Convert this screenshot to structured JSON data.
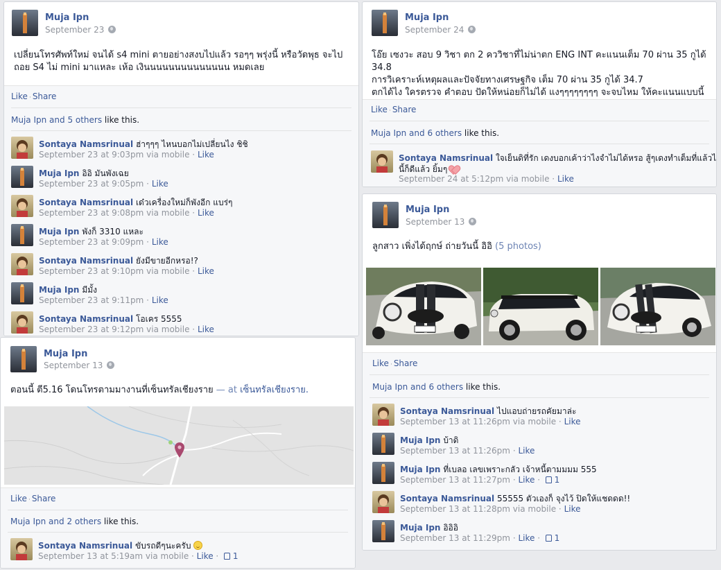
{
  "post1": {
    "author": "Muja Ipn",
    "date": "September 23",
    "text": "เปลี่ยนโทรศัพท์ใหม่ จนได้ s4 mini ตายอย่างสงบไปแล้ว รอๆๆ พรุ่งนี้ หรือวัดพุธ จะไปถอย S4 ไม่ mini มาแหละ เห้อ เงินนนนนนนนนนนนนน หมดเลย",
    "like_label": "Like",
    "share_label": "Share",
    "likes_prefix": "Muja Ipn and ",
    "likes_link": "5 others",
    "likes_suffix": " like this.",
    "comments": [
      {
        "name": "Sontaya Namsrinual",
        "text": "ฮ่าๆๆๆ ไหนบอกไม่เปลี่ยนไง ชิชิ",
        "meta": "September 23 at 9:03pm via mobile",
        "like": "Like"
      },
      {
        "name": "Muja Ipn",
        "text": "อิอิ มันพังเฉย",
        "meta": "September 23 at 9:05pm",
        "like": "Like"
      },
      {
        "name": "Sontaya Namsrinual",
        "text": "เด๋วเครื่องใหม่ก็พังอีก แบร่ๆ",
        "meta": "September 23 at 9:08pm via mobile",
        "like": "Like"
      },
      {
        "name": "Muja Ipn",
        "text": "พังก็ 3310 แหละ",
        "meta": "September 23 at 9:09pm",
        "like": "Like"
      },
      {
        "name": "Sontaya Namsrinual",
        "text": "ยังมีขายอีกหรอ!?",
        "meta": "September 23 at 9:10pm via mobile",
        "like": "Like"
      },
      {
        "name": "Muja Ipn",
        "text": "มีมั้ง",
        "meta": "September 23 at 9:11pm",
        "like": "Like"
      },
      {
        "name": "Sontaya Namsrinual",
        "text": "โอเคร 5555",
        "meta": "September 23 at 9:12pm via mobile",
        "like": "Like"
      }
    ]
  },
  "post2": {
    "author": "Muja Ipn",
    "date": "September 24",
    "line1": "โอ๊ย เซงวะ สอบ 9 วิชา ตก 2 คววิชาที่ไม่น่าตก ENG INT คะแนนเต็ม 70 ผ่าน 35 กูได้ 34.8",
    "line2": "การวิเคราะห์เหตุผลและปัจจัยทางเศรษฐกิจ เต็ม 70 ผ่าน 35 กูได้ 34.7",
    "line3": "ตกได้ไง ใครตรวจ คำตอบ ปัดให้หน่อยก็ไม่ได้ แงๆๆๆๆๆๆๆๆ จะจบไหม ให้คะแนนแบบนี้",
    "like_label": "Like",
    "share_label": "Share",
    "likes_prefix": "Muja Ipn and ",
    "likes_link": "6 others",
    "likes_suffix": " like this.",
    "comment": {
      "name": "Sontaya Namsrinual",
      "text1": "ใจเย็นดิที่รัก เดงบอกเค้าว่าไงจำไม่ได้หรอ สู้ๆเดงทำเต็มที่แล้วได้เท่า",
      "text2": "นี้ก็ดีแล้ว ยิ้มๆ",
      "meta": "September 24 at 5:12pm via mobile",
      "like": "Like"
    }
  },
  "post3": {
    "author": "Muja Ipn",
    "date": "September 13",
    "text": "ตอนนี้ ตี5.16 โดนโทรตามมางานที่เซ็นทรัลเชียงราย",
    "at_dash": " — at ",
    "place": "เซ็นทรัลเชียงราย.",
    "like_label": "Like",
    "share_label": "Share",
    "likes_prefix": "Muja Ipn and ",
    "likes_link": "2 others",
    "likes_suffix": " like this.",
    "comment": {
      "name": "Sontaya Namsrinual",
      "text": "ขับรถดีๆนะครับ",
      "meta": "September 13 at 5:19am via mobile",
      "like": "Like",
      "thumb": "1"
    }
  },
  "post4": {
    "author": "Muja Ipn",
    "date": "September 13",
    "text": "ลูกสาว เพิ่งได้ฤกษ์ ถ่ายวันนี้ อิอิ",
    "photos_count": "(5 photos)",
    "like_label": "Like",
    "share_label": "Share",
    "likes_prefix": "Muja Ipn and ",
    "likes_link": "6 others",
    "likes_suffix": " like this.",
    "comments": [
      {
        "name": "Sontaya Namsrinual",
        "text": "ไปแอบถ่ายรถคัยมาล่ะ",
        "meta": "September 13 at 11:26pm via mobile",
        "like": "Like",
        "thumb": ""
      },
      {
        "name": "Muja Ipn",
        "text": "บ้าดิ",
        "meta": "September 13 at 11:26pm",
        "like": "Like",
        "thumb": ""
      },
      {
        "name": "Muja Ipn",
        "text": "ที่เบลอ เลขเพราะกลัว เจ้าหนี้ตามมมม 555",
        "meta": "September 13 at 11:27pm",
        "like": "Like",
        "thumb": "1"
      },
      {
        "name": "Sontaya Namsrinual",
        "text": "55555 ตัวเองก็ จุงไว้ ปิดให้แชดดด!!",
        "meta": "September 13 at 11:28pm via mobile",
        "like": "Like",
        "thumb": ""
      },
      {
        "name": "Muja Ipn",
        "text": "อิอิอิ",
        "meta": "September 13 at 11:29pm",
        "like": "Like",
        "thumb": "1"
      }
    ]
  }
}
